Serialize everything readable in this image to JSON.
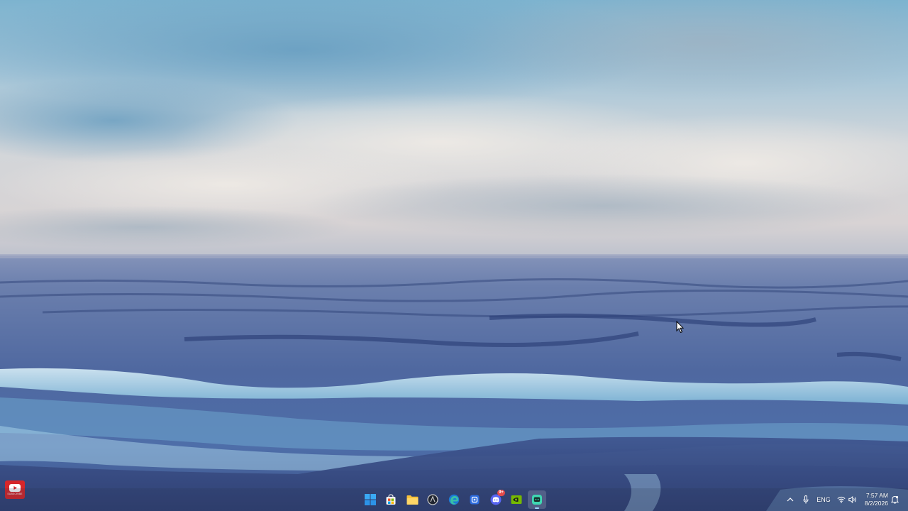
{
  "desktop": {
    "wallpaper": "ocean-waves-under-cloudy-sky",
    "colors": {
      "sky_top": "#7fb7d3",
      "sky_mid": "#c7d3dc",
      "horizon": "#c9c8cf",
      "sea_far": "#5d76a6",
      "sea_mid": "#4e6aa2",
      "foam": "#b9dff0",
      "sea_near": "#3e5690"
    }
  },
  "overlay": {
    "youtube": {
      "icon": "youtube-icon",
      "label": "SUBSCRIBE",
      "color": "#d6262a"
    }
  },
  "taskbar": {
    "apps": [
      {
        "name": "Start",
        "icon": "windows-start-icon"
      },
      {
        "name": "Microsoft Store",
        "icon": "store-icon"
      },
      {
        "name": "File Explorer",
        "icon": "folder-icon"
      },
      {
        "name": "App",
        "icon": "circle-app-icon"
      },
      {
        "name": "Microsoft Edge",
        "icon": "edge-icon"
      },
      {
        "name": "App",
        "icon": "blue-app-icon"
      },
      {
        "name": "Discord",
        "icon": "discord-icon",
        "badge": "9+"
      },
      {
        "name": "NVIDIA",
        "icon": "nvidia-icon"
      },
      {
        "name": "App",
        "icon": "green-app-icon",
        "active": true
      }
    ],
    "tray": {
      "chevron_icon": "chevron-up-icon",
      "mic_icon": "microphone-icon",
      "language": "ENG",
      "wifi_icon": "wifi-icon",
      "volume_icon": "speaker-icon",
      "time": "7:57 AM",
      "date": "8/2/2026",
      "notification_icon": "notification-icon"
    }
  }
}
